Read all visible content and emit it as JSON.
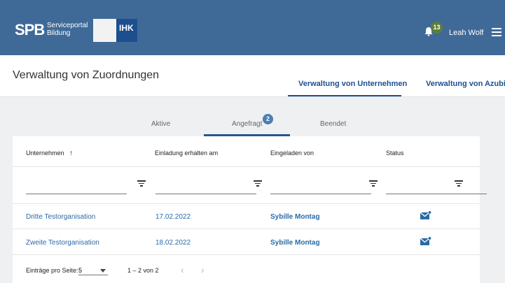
{
  "header": {
    "logo_text": "SPB",
    "logo_sub_line1": "Serviceportal",
    "logo_sub_line2": "Bildung",
    "ihk_text": "IHK",
    "notification_count": "13",
    "user_name": "Leah Wolf"
  },
  "page": {
    "title": "Verwaltung von Zuordnungen",
    "tabs": [
      {
        "label": "Verwaltung von Unternehmen",
        "active": true
      },
      {
        "label": "Verwaltung von Azubis",
        "active": false
      }
    ]
  },
  "subtabs": [
    {
      "label": "Aktive"
    },
    {
      "label": "Angefragt",
      "badge": "2",
      "active": true
    },
    {
      "label": "Beendet"
    }
  ],
  "table": {
    "columns": [
      "Unternehmen",
      "Einladung erhalten am",
      "Eingeladen von",
      "Status"
    ],
    "sort_arrow": "↑",
    "rows": [
      {
        "company": "Dritte Testorganisation",
        "date": "17.02.2022",
        "invited_by": "Sybille Montag"
      },
      {
        "company": "Zweite Testorganisation",
        "date": "18.02.2022",
        "invited_by": "Sybille Montag"
      }
    ]
  },
  "pagination": {
    "label": "Einträge pro Seite:",
    "page_size": "5",
    "range": "1 – 2 von 2",
    "prev": "‹",
    "next": "›"
  },
  "colors": {
    "header_bg": "#3f6a97",
    "accent": "#1d4f8f",
    "link": "#2a6aa8",
    "notification_badge": "#5d7f3a"
  },
  "icons": [
    "bell-icon",
    "menu-icon",
    "filter-icon",
    "sort-up-icon",
    "mail-icon",
    "dropdown-icon"
  ]
}
